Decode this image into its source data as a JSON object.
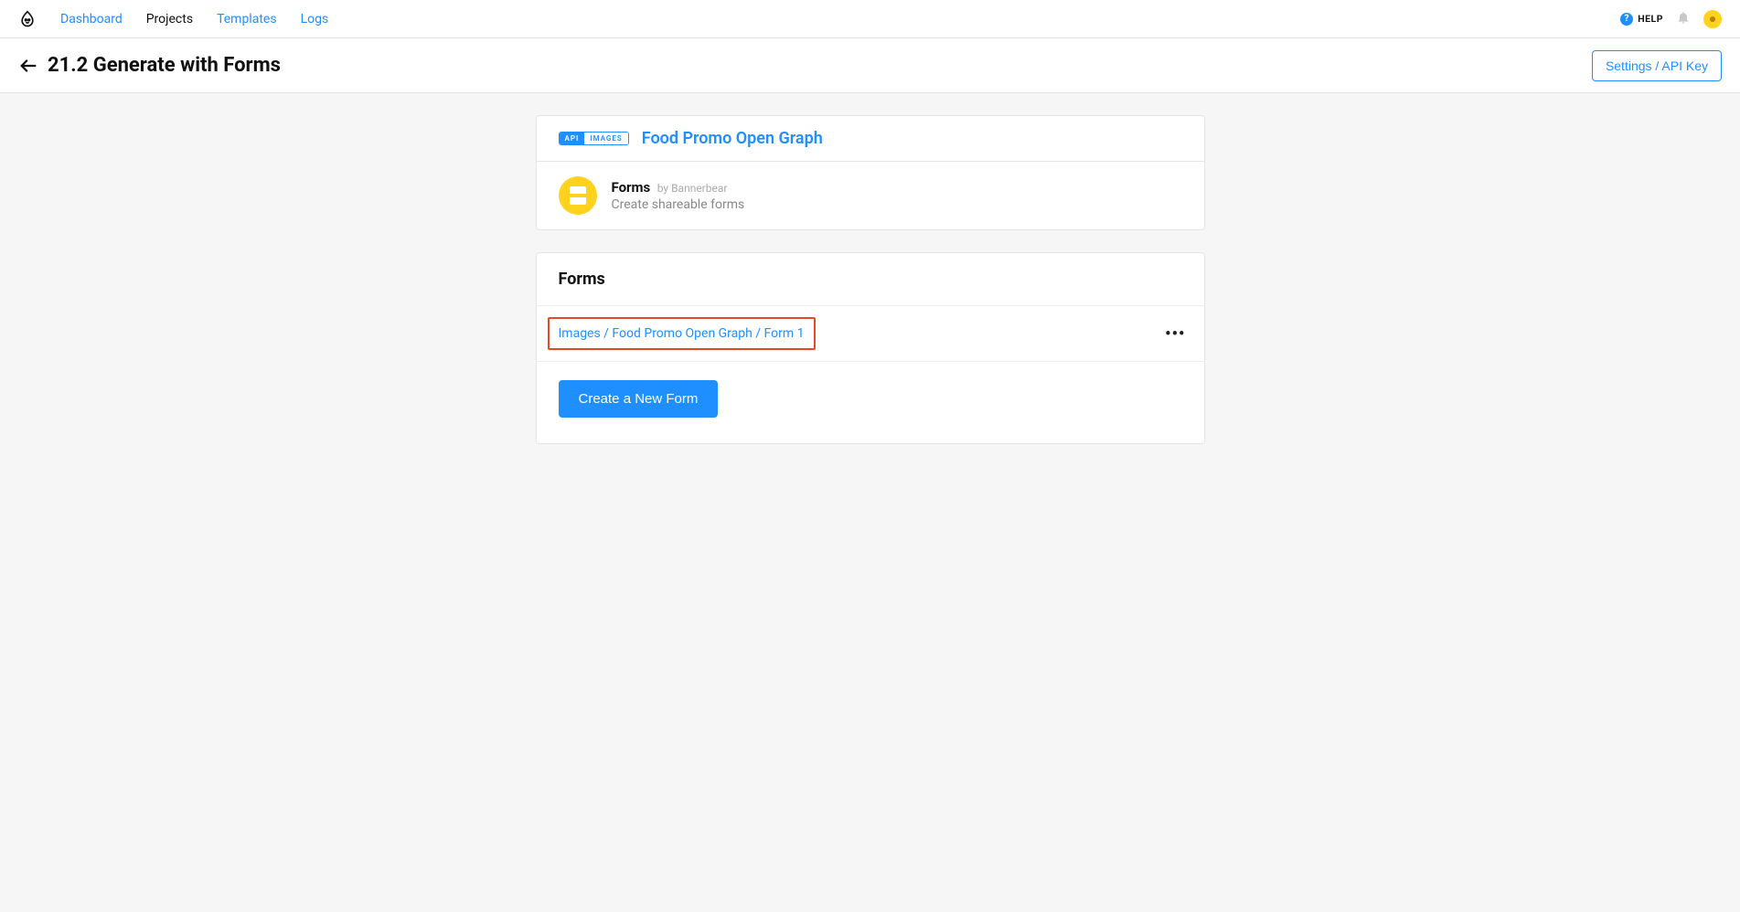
{
  "nav": {
    "items": [
      {
        "label": "Dashboard",
        "active": false
      },
      {
        "label": "Projects",
        "active": true
      },
      {
        "label": "Templates",
        "active": false
      },
      {
        "label": "Logs",
        "active": false
      }
    ],
    "help_label": "HELP"
  },
  "header": {
    "title": "21.2 Generate with Forms",
    "settings_label": "Settings / API Key"
  },
  "template_card": {
    "badge_left": "API",
    "badge_right": "IMAGES",
    "title": "Food Promo Open Graph",
    "app_title": "Forms",
    "app_byline": "by Bannerbear",
    "app_desc": "Create shareable forms"
  },
  "forms_card": {
    "heading": "Forms",
    "rows": [
      {
        "label": "Images / Food Promo Open Graph / Form 1"
      }
    ],
    "create_label": "Create a New Form"
  }
}
